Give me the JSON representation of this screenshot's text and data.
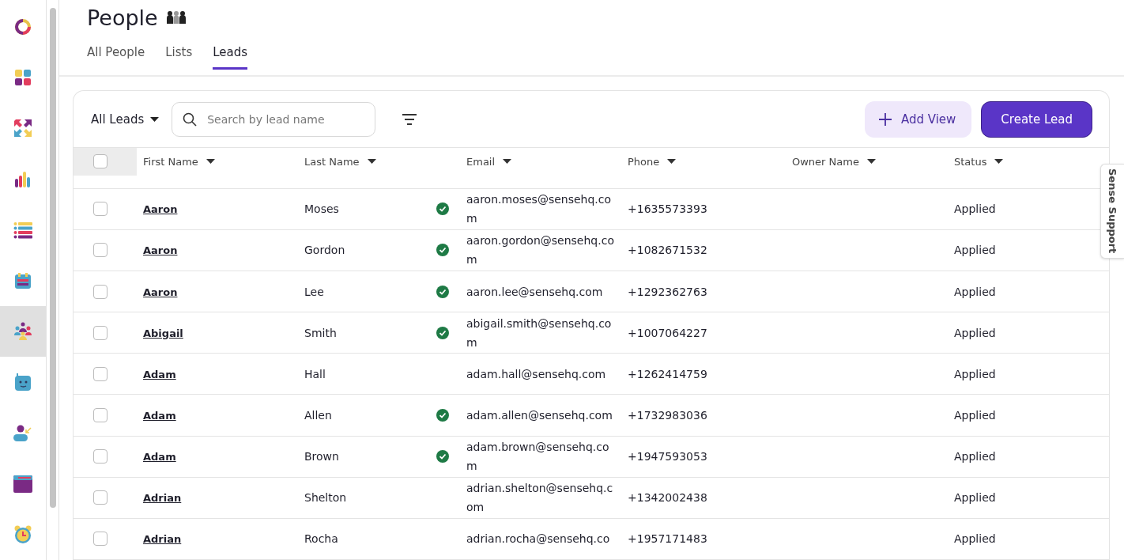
{
  "sidebar": {
    "items": [
      {
        "kind": "ring",
        "selected": false
      },
      {
        "kind": "grid",
        "selected": false
      },
      {
        "kind": "arrows",
        "selected": false
      },
      {
        "kind": "bars",
        "selected": false
      },
      {
        "kind": "list",
        "selected": false
      },
      {
        "kind": "calendar",
        "selected": false
      },
      {
        "kind": "people",
        "selected": true
      },
      {
        "kind": "robot",
        "selected": false
      },
      {
        "kind": "person",
        "selected": false
      },
      {
        "kind": "window",
        "selected": false
      },
      {
        "kind": "clock",
        "selected": false
      }
    ]
  },
  "page": {
    "title": "People"
  },
  "tabs": [
    {
      "label": "All People",
      "selected": false
    },
    {
      "label": "Lists",
      "selected": false
    },
    {
      "label": "Leads",
      "selected": true
    }
  ],
  "toolbar": {
    "view": "All Leads",
    "search": {
      "placeholder": "Search by lead name"
    },
    "add_view": "Add View",
    "create": "Create Lead"
  },
  "table": {
    "select_all": {
      "checked": false
    },
    "columns": [
      "First Name",
      "Last Name",
      "Email",
      "Phone",
      "Owner Name",
      "Status"
    ],
    "rows": [
      {
        "first": "Aaron",
        "last": "Moses",
        "verified": true,
        "email": "aaron.moses@sensehq.com",
        "phone": "+1635573393",
        "status": "Applied",
        "checked": false
      },
      {
        "first": "Aaron",
        "last": "Gordon",
        "verified": true,
        "email": "aaron.gordon@sensehq.com",
        "phone": "+1082671532",
        "status": "Applied",
        "checked": false
      },
      {
        "first": "Aaron",
        "last": "Lee",
        "verified": true,
        "email": "aaron.lee@sensehq.com",
        "phone": "+1292362763",
        "status": "Applied",
        "checked": false
      },
      {
        "first": "Abigail",
        "last": "Smith",
        "verified": true,
        "email": "abigail.smith@sensehq.com",
        "phone": "+1007064227",
        "status": "Applied",
        "checked": false
      },
      {
        "first": "Adam",
        "last": "Hall",
        "verified": false,
        "email": "adam.hall@sensehq.com",
        "phone": "+1262414759",
        "status": "Applied",
        "checked": false
      },
      {
        "first": "Adam",
        "last": "Allen",
        "verified": true,
        "email": "adam.allen@sensehq.com",
        "phone": "+1732983036",
        "status": "Applied",
        "checked": false
      },
      {
        "first": "Adam",
        "last": "Brown",
        "verified": true,
        "email": "adam.brown@sensehq.com",
        "phone": "+1947593053",
        "status": "Applied",
        "checked": false
      },
      {
        "first": "Adrian",
        "last": "Shelton",
        "verified": false,
        "email": "adrian.shelton@sensehq.com",
        "phone": "+1342002438",
        "status": "Applied",
        "checked": false
      },
      {
        "first": "Adrian",
        "last": "Rocha",
        "verified": false,
        "email": "adrian.rocha@sensehq.co",
        "phone": "+1957171483",
        "status": "Applied",
        "checked": false
      }
    ]
  },
  "support_tab": "Sense Support"
}
